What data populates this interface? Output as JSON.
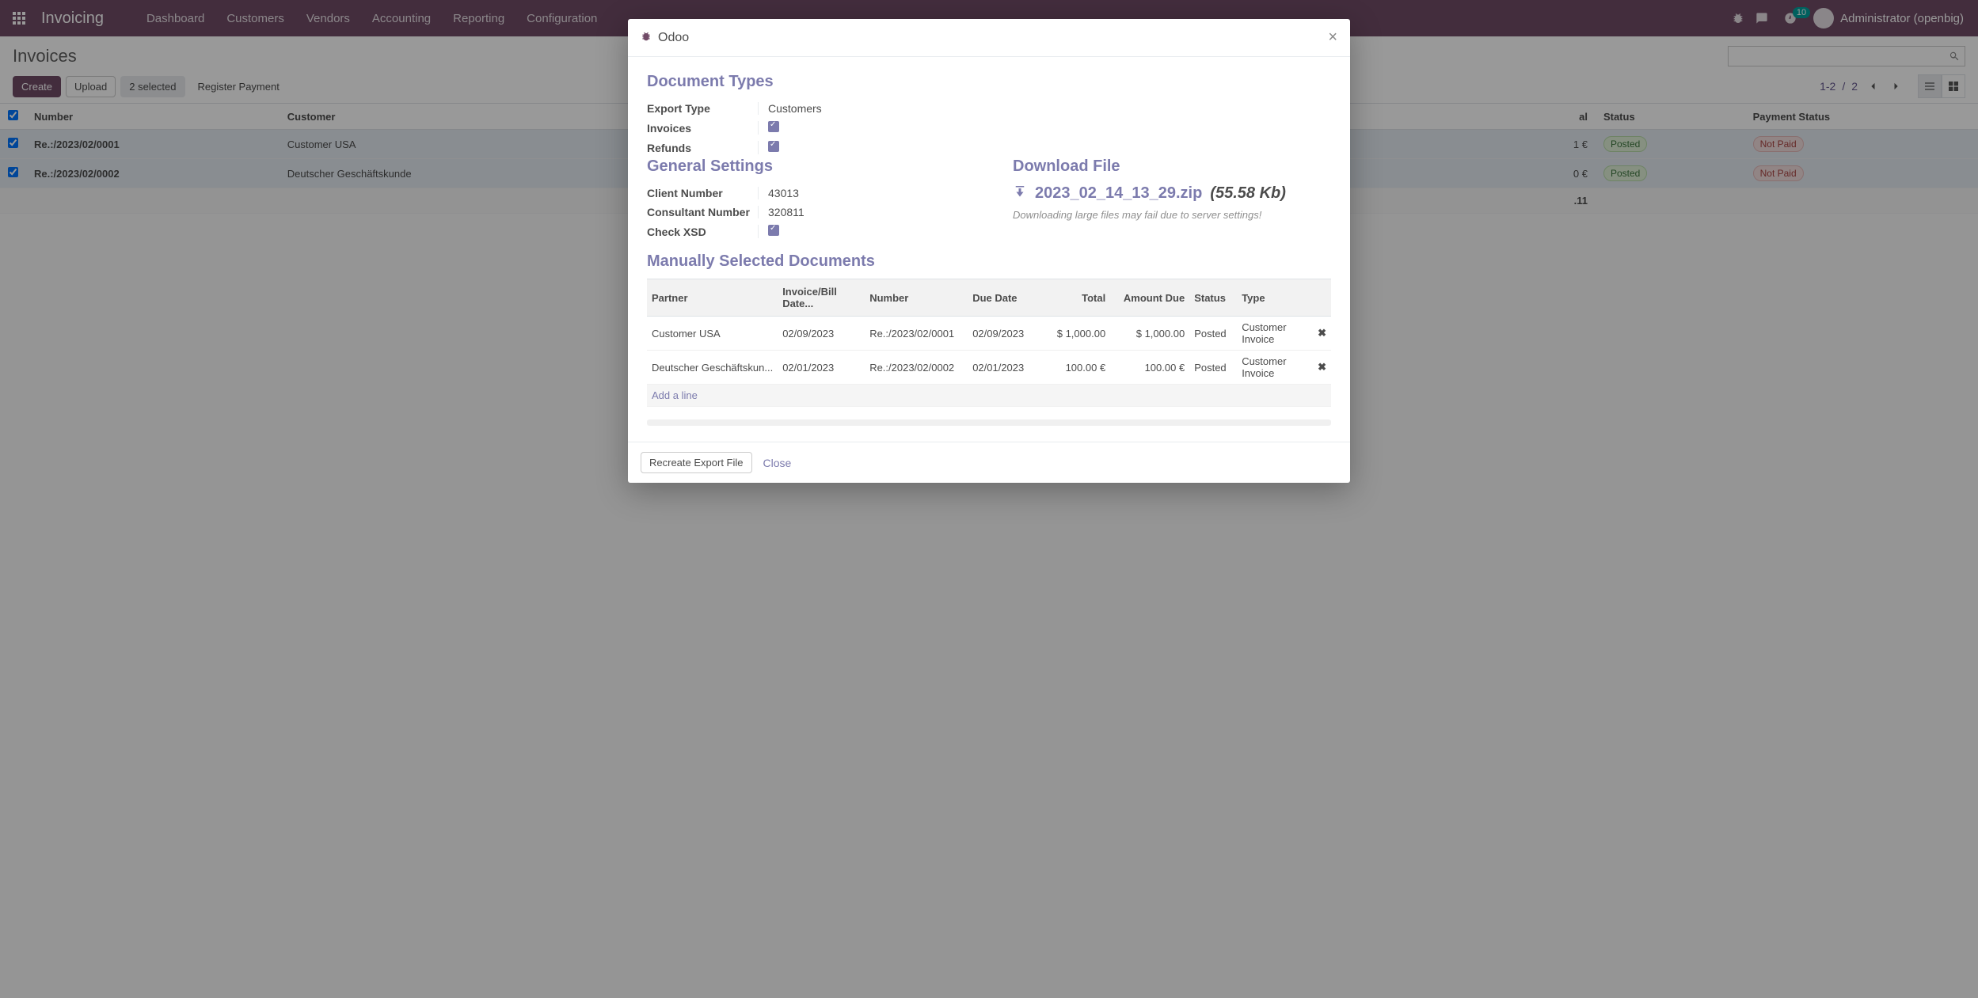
{
  "brand": "Invoicing",
  "topnav": [
    "Dashboard",
    "Customers",
    "Vendors",
    "Accounting",
    "Reporting",
    "Configuration"
  ],
  "notif_count": "10",
  "user": "Administrator (openbig)",
  "breadcrumb": "Invoices",
  "buttons": {
    "create": "Create",
    "upload": "Upload",
    "selected": "2 selected",
    "register": "Register Payment"
  },
  "pager": {
    "range": "1-2",
    "sep": "/",
    "total": "2"
  },
  "list": {
    "headers": {
      "number": "Number",
      "customer": "Customer",
      "tax_total": "Tax Total",
      "status": "Status",
      "payment_status": "Payment Status"
    },
    "rows": [
      {
        "number": "Re.:/2023/02/0001",
        "customer": "Customer USA",
        "tax_total": "1 €",
        "status": "Posted",
        "payment": "Not Paid"
      },
      {
        "number": "Re.:/2023/02/0002",
        "customer": "Deutscher Geschäftskunde",
        "tax_total": "0 €",
        "status": "Posted",
        "payment": "Not Paid"
      }
    ],
    "total_caption": ".11"
  },
  "modal": {
    "title": "Odoo",
    "sections": {
      "doc_types": "Document Types",
      "general": "General Settings",
      "download": "Download File",
      "manual": "Manually Selected Documents"
    },
    "doc_types": {
      "export_type_label": "Export Type",
      "export_type_value": "Customers",
      "invoices_label": "Invoices",
      "refunds_label": "Refunds"
    },
    "general": {
      "client_label": "Client Number",
      "client_value": "43013",
      "consultant_label": "Consultant Number",
      "consultant_value": "320811",
      "xsd_label": "Check XSD"
    },
    "download": {
      "filename": "2023_02_14_13_29.zip",
      "size": "(55.58 Kb)",
      "note": "Downloading large files may fail due to server settings!"
    },
    "docs": {
      "headers": {
        "partner": "Partner",
        "date": "Invoice/Bill Date...",
        "number": "Number",
        "due": "Due Date",
        "total": "Total",
        "amount_due": "Amount Due",
        "status": "Status",
        "type": "Type"
      },
      "rows": [
        {
          "partner": "Customer USA",
          "date": "02/09/2023",
          "number": "Re.:/2023/02/0001",
          "due": "02/09/2023",
          "total": "$ 1,000.00",
          "amount_due": "$ 1,000.00",
          "status": "Posted",
          "type": "Customer Invoice"
        },
        {
          "partner": "Deutscher Geschäftskun...",
          "date": "02/01/2023",
          "number": "Re.:/2023/02/0002",
          "due": "02/01/2023",
          "total": "100.00 €",
          "amount_due": "100.00 €",
          "status": "Posted",
          "type": "Customer Invoice"
        }
      ],
      "add_line": "Add a line"
    },
    "footer": {
      "recreate": "Recreate Export File",
      "close": "Close"
    }
  }
}
